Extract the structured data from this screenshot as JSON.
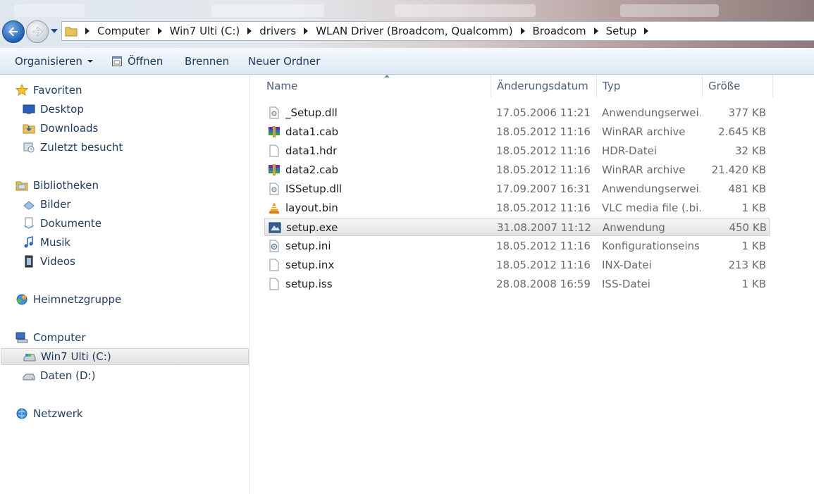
{
  "breadcrumb": [
    "Computer",
    "Win7 Ulti (C:)",
    "drivers",
    "WLAN Driver (Broadcom, Qualcomm)",
    "Broadcom",
    "Setup"
  ],
  "toolbar": {
    "organize": "Organisieren",
    "open": "Öffnen",
    "burn": "Brennen",
    "new_folder": "Neuer Ordner"
  },
  "nav": {
    "favorites": {
      "label": "Favoriten",
      "items": [
        "Desktop",
        "Downloads",
        "Zuletzt besucht"
      ]
    },
    "libraries": {
      "label": "Bibliotheken",
      "items": [
        "Bilder",
        "Dokumente",
        "Musik",
        "Videos"
      ]
    },
    "homegroup": "Heimnetzgruppe",
    "computer": {
      "label": "Computer",
      "items": [
        "Win7 Ulti (C:)",
        "Daten (D:)"
      ]
    },
    "network": "Netzwerk"
  },
  "columns": {
    "name": "Name",
    "date": "Änderungsdatum",
    "type": "Typ",
    "size": "Größe"
  },
  "files": [
    {
      "name": "_Setup.dll",
      "date": "17.05.2006 11:21",
      "type": "Anwendungserwei...",
      "size": "377 KB",
      "icon": "dll-icon"
    },
    {
      "name": "data1.cab",
      "date": "18.05.2012 11:16",
      "type": "WinRAR archive",
      "size": "2.645 KB",
      "icon": "winrar-icon"
    },
    {
      "name": "data1.hdr",
      "date": "18.05.2012 11:16",
      "type": "HDR-Datei",
      "size": "32 KB",
      "icon": "file-icon"
    },
    {
      "name": "data2.cab",
      "date": "18.05.2012 11:16",
      "type": "WinRAR archive",
      "size": "21.420 KB",
      "icon": "winrar-icon"
    },
    {
      "name": "ISSetup.dll",
      "date": "17.09.2007 16:31",
      "type": "Anwendungserwei...",
      "size": "481 KB",
      "icon": "dll-icon"
    },
    {
      "name": "layout.bin",
      "date": "18.05.2012 11:16",
      "type": "VLC media file (.bi...",
      "size": "1 KB",
      "icon": "vlc-icon"
    },
    {
      "name": "setup.exe",
      "date": "31.08.2007 11:12",
      "type": "Anwendung",
      "size": "450 KB",
      "icon": "exe-icon"
    },
    {
      "name": "setup.ini",
      "date": "18.05.2012 11:16",
      "type": "Konfigurationseins...",
      "size": "1 KB",
      "icon": "ini-icon"
    },
    {
      "name": "setup.inx",
      "date": "18.05.2012 11:16",
      "type": "INX-Datei",
      "size": "213 KB",
      "icon": "file-icon"
    },
    {
      "name": "setup.iss",
      "date": "28.08.2008 16:59",
      "type": "ISS-Datei",
      "size": "1 KB",
      "icon": "file-icon"
    }
  ],
  "selected_file": "setup.exe",
  "selected_nav": "Win7 Ulti (C:)"
}
